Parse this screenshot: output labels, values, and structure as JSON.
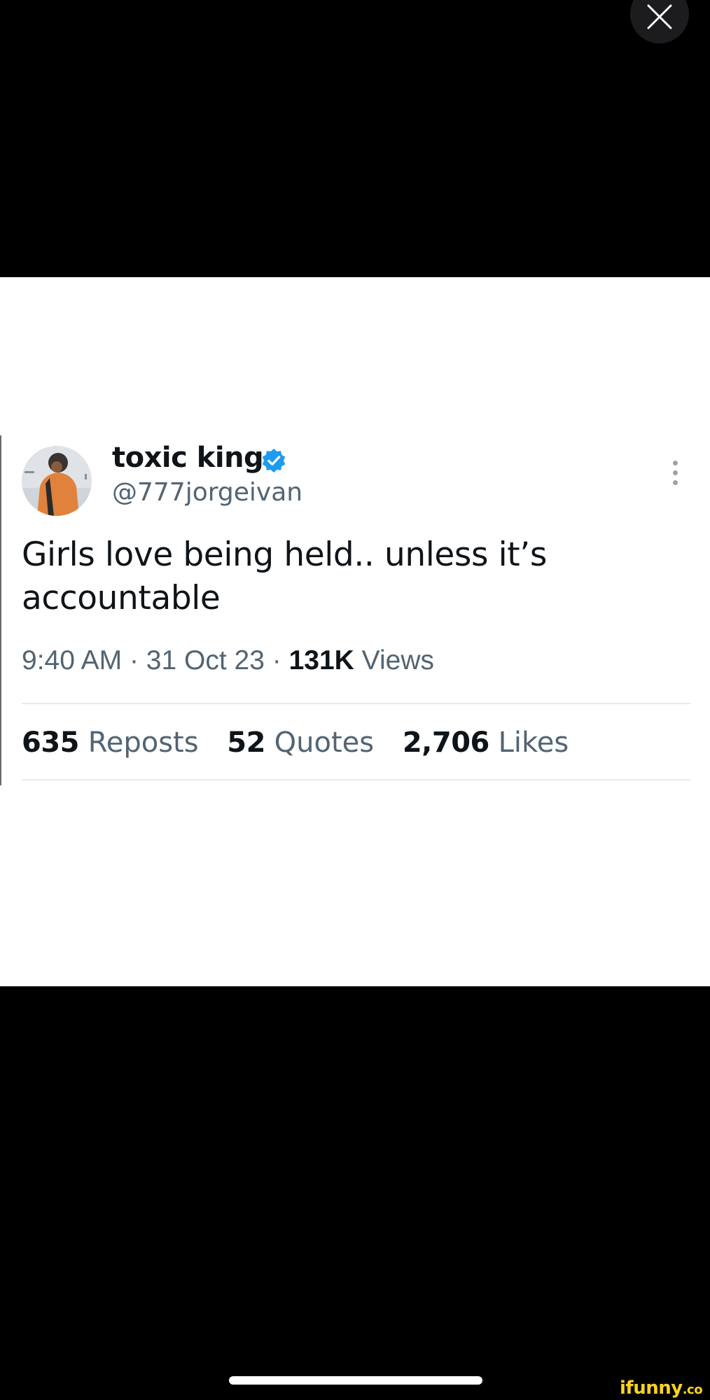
{
  "tweet": {
    "display_name": "toxic king",
    "handle": "@777jorgeivan",
    "text": "Girls love being held.. unless it’s accountable",
    "time": "9:40 AM",
    "date": "31 Oct 23",
    "views_count": "131K",
    "views_label": "Views",
    "separator": "·",
    "stats": [
      {
        "count": "635",
        "label": "Reposts"
      },
      {
        "count": "52",
        "label": "Quotes"
      },
      {
        "count": "2,706",
        "label": "Likes"
      }
    ]
  },
  "watermark": {
    "brand": "ifunny",
    "tld": ".co"
  },
  "icons": {
    "close": "close-icon",
    "verified": "verified-badge-icon",
    "more": "more-vertical-icon"
  },
  "colors": {
    "verified_blue": "#1d9bf0",
    "watermark_yellow": "#ffd21e",
    "secondary_text": "#536471"
  }
}
